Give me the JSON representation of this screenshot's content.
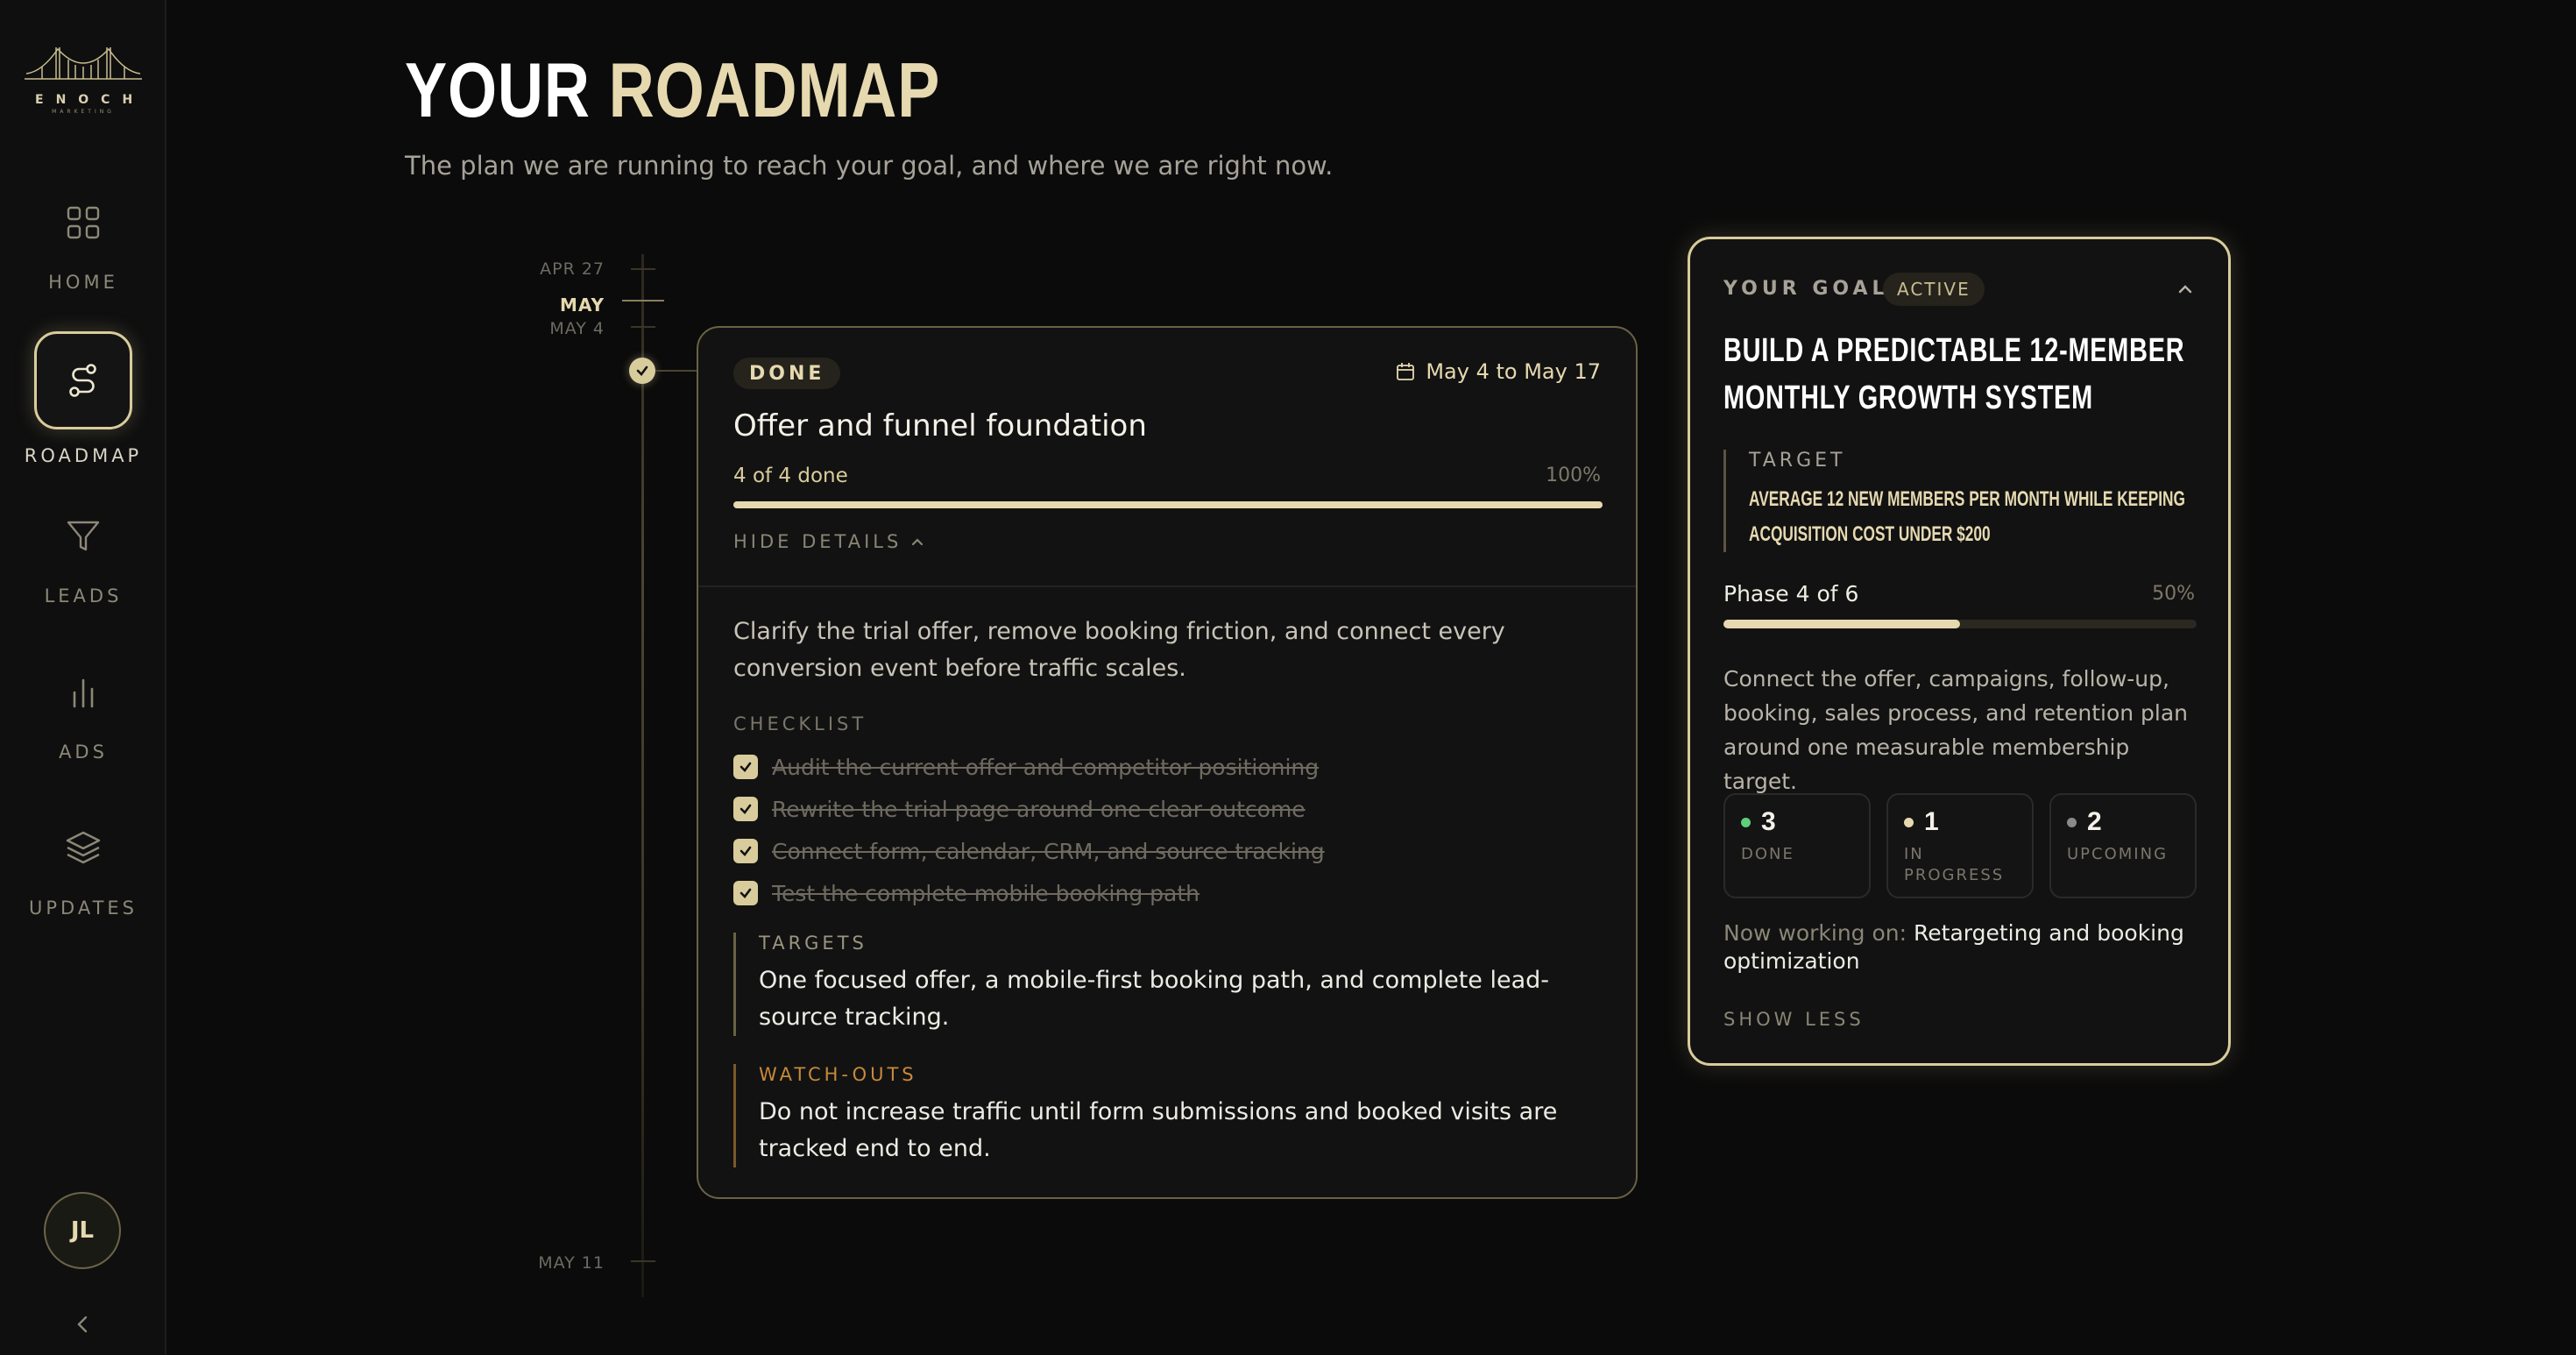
{
  "brand": {
    "name": "ENOCH",
    "tagline": "MARKETING"
  },
  "sidebar": {
    "items": [
      {
        "label": "HOME",
        "icon": "grid-icon"
      },
      {
        "label": "ROADMAP",
        "icon": "route-icon",
        "active": true
      },
      {
        "label": "LEADS",
        "icon": "filter-icon"
      },
      {
        "label": "ADS",
        "icon": "bar-chart-icon"
      },
      {
        "label": "UPDATES",
        "icon": "layers-icon"
      }
    ],
    "avatar_initials": "JL"
  },
  "header": {
    "title_part1": "YOUR",
    "title_part2": "ROADMAP",
    "subtitle": "The plan we are running to reach your goal, and where we are right now."
  },
  "timeline": {
    "labels": [
      "APR 27",
      "MAY",
      "MAY 4",
      "MAY 11"
    ]
  },
  "phase": {
    "status": "DONE",
    "date_range": "May 4 to May 17",
    "title": "Offer and funnel foundation",
    "progress_text": "4 of 4 done",
    "progress_pct_text": "100%",
    "progress_fraction": 1.0,
    "toggle_label": "HIDE DETAILS",
    "description": "Clarify the trial offer, remove booking friction, and connect every conversion event before traffic scales.",
    "checklist_label": "CHECKLIST",
    "checklist": [
      "Audit the current offer and competitor positioning",
      "Rewrite the trial page around one clear outcome",
      "Connect form, calendar, CRM, and source tracking",
      "Test the complete mobile booking path"
    ],
    "targets_label": "TARGETS",
    "targets_text": "One focused offer, a mobile-first booking path, and complete lead-source tracking.",
    "watchouts_label": "WATCH-OUTS",
    "watchouts_text": "Do not increase traffic until form submissions and booked visits are tracked end to end."
  },
  "goal": {
    "label": "YOUR GOAL",
    "badge": "ACTIVE",
    "title": "BUILD A PREDICTABLE 12-MEMBER MONTHLY GROWTH SYSTEM",
    "target_label": "TARGET",
    "target_text": "AVERAGE 12 NEW MEMBERS PER MONTH WHILE KEEPING ACQUISITION COST UNDER $200",
    "phase_text": "Phase 4 of 6",
    "phase_pct_text": "50%",
    "phase_fraction": 0.5,
    "description": "Connect the offer, campaigns, follow-up, booking, sales process, and retention plan around one measurable membership target.",
    "stats": [
      {
        "value": "3",
        "label": "DONE",
        "color": "#5fcf7a"
      },
      {
        "value": "1",
        "label": "IN PROGRESS",
        "color": "#e6d9b0"
      },
      {
        "value": "2",
        "label": "UPCOMING",
        "color": "#8a8a8a"
      }
    ],
    "now_working_label": "Now working on:",
    "now_working_value": "Retargeting and booking optimization",
    "show_less": "SHOW LESS"
  }
}
